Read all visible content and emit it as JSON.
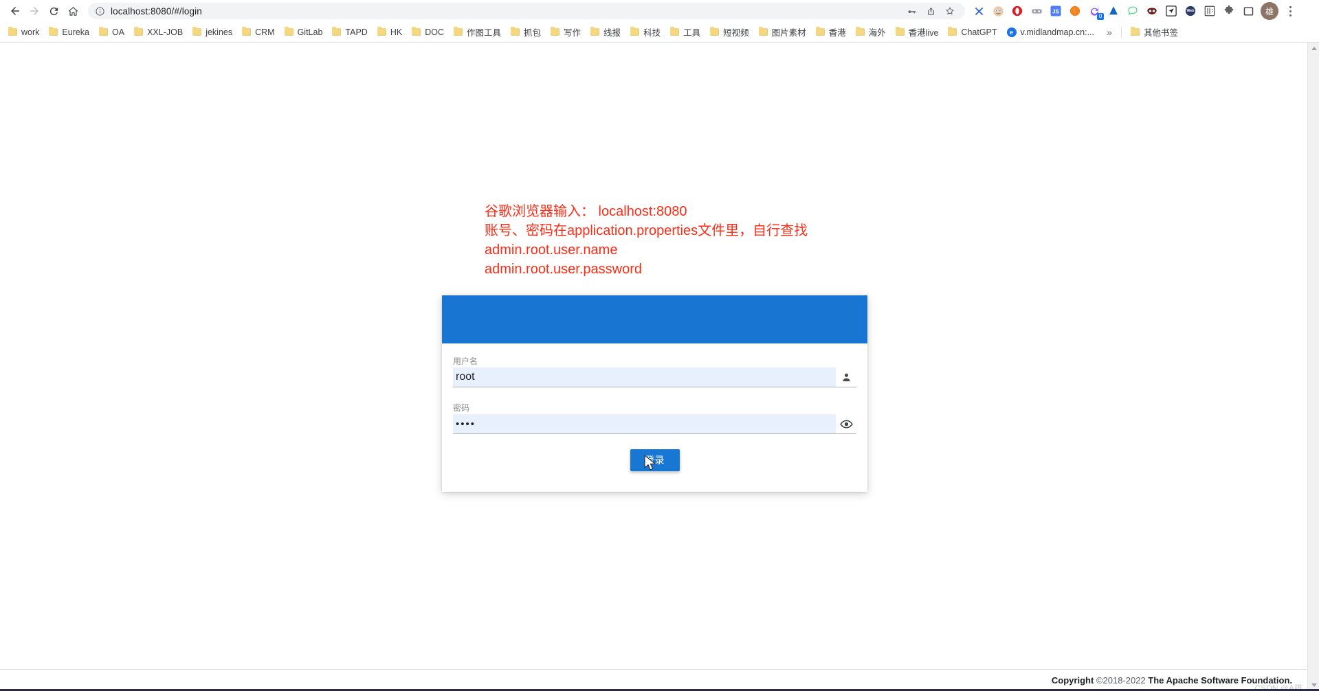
{
  "browser": {
    "nav": {
      "back_label": "Back",
      "forward_label": "Forward",
      "reload_label": "Reload",
      "home_label": "Home"
    },
    "omnibox": {
      "url": "localhost:8080/#/login",
      "info_icon": "info-circle-icon",
      "actions": [
        "key-icon",
        "share-icon",
        "star-icon"
      ]
    },
    "extensions": [
      {
        "name": "x-extension-icon",
        "glyph": "X",
        "color": "#1a73e8"
      },
      {
        "name": "face-extension-icon",
        "glyph": "●",
        "color": "#e8c29a"
      },
      {
        "name": "opera-extension-icon",
        "glyph": "●",
        "color": "#e01c24"
      },
      {
        "name": "glasses-extension-icon",
        "glyph": "●",
        "color": "#9aa0a6"
      },
      {
        "name": "js-extension-icon",
        "glyph": "JS",
        "color": "#4d7cfe"
      },
      {
        "name": "orange-extension-icon",
        "glyph": "●",
        "color": "#f4821f"
      },
      {
        "name": "refresh-counter-extension-icon",
        "glyph": "↻",
        "color": "#8a5cf6",
        "badge": "0"
      },
      {
        "name": "blue-drop-extension-icon",
        "glyph": "▲",
        "color": "#1565c0"
      },
      {
        "name": "chat-extension-icon",
        "glyph": "○",
        "color": "#3ddc84"
      },
      {
        "name": "mask-extension-icon",
        "glyph": "●",
        "color": "#8b1a1a"
      },
      {
        "name": "paperplane-extension-icon",
        "glyph": "➤",
        "color": "#202124"
      },
      {
        "name": "web-badge-extension-icon",
        "glyph": "W",
        "color": "#2b3a67"
      },
      {
        "name": "chinese-extension-icon",
        "glyph": "巴",
        "color": "#4a4a4a"
      },
      {
        "name": "puzzle-extensions-icon",
        "glyph": "❖",
        "color": "#5f6368"
      },
      {
        "name": "sidepanel-icon",
        "glyph": "□",
        "color": "#3c4043"
      }
    ],
    "avatar": {
      "name": "profile-avatar",
      "initial": "雄"
    },
    "menu": {
      "name": "chrome-menu-button"
    },
    "bookmarks": [
      {
        "label": "work",
        "icon": "folder-icon"
      },
      {
        "label": "Eureka",
        "icon": "folder-icon"
      },
      {
        "label": "OA",
        "icon": "folder-icon"
      },
      {
        "label": "XXL-JOB",
        "icon": "folder-icon"
      },
      {
        "label": "jekines",
        "icon": "folder-icon"
      },
      {
        "label": "CRM",
        "icon": "folder-icon"
      },
      {
        "label": "GitLab",
        "icon": "folder-icon"
      },
      {
        "label": "TAPD",
        "icon": "folder-icon"
      },
      {
        "label": "HK",
        "icon": "folder-icon"
      },
      {
        "label": "DOC",
        "icon": "folder-icon"
      },
      {
        "label": "作图工具",
        "icon": "folder-icon"
      },
      {
        "label": "抓包",
        "icon": "folder-icon"
      },
      {
        "label": "写作",
        "icon": "folder-icon"
      },
      {
        "label": "线报",
        "icon": "folder-icon"
      },
      {
        "label": "科技",
        "icon": "folder-icon"
      },
      {
        "label": "工具",
        "icon": "folder-icon"
      },
      {
        "label": "短视频",
        "icon": "folder-icon"
      },
      {
        "label": "图片素材",
        "icon": "folder-icon"
      },
      {
        "label": "香港",
        "icon": "folder-icon"
      },
      {
        "label": "海外",
        "icon": "folder-icon"
      },
      {
        "label": "香港live",
        "icon": "folder-icon"
      },
      {
        "label": "ChatGPT",
        "icon": "folder-icon"
      },
      {
        "label": "v.midlandmap.cn:...",
        "icon": "site-icon"
      }
    ],
    "bookmarks_overflow_label": "»",
    "other_bookmarks": {
      "label": "其他书签",
      "icon": "folder-icon"
    }
  },
  "annotation": {
    "lines": [
      "谷歌浏览器输入： localhost:8080",
      "账号、密码在application.properties文件里，自行查找",
      "admin.root.user.name",
      "admin.root.user.password"
    ],
    "color": "#ff2d16"
  },
  "login": {
    "header_color": "#1876d2",
    "username": {
      "label": "用户名",
      "value": "root",
      "placeholder": "用户名",
      "icon": "person-icon"
    },
    "password": {
      "label": "密码",
      "value": "••••",
      "placeholder": "密码",
      "icon": "eye-icon"
    },
    "submit": {
      "label": "登录",
      "icon": "send-arrow-icon",
      "color": "#1877d2"
    }
  },
  "footer": {
    "copyright_word": "Copyright",
    "copyright_years": "©2018-2022",
    "copyright_owner": "The Apache Software Foundation.",
    "watermark": "CSDN @A雄"
  }
}
